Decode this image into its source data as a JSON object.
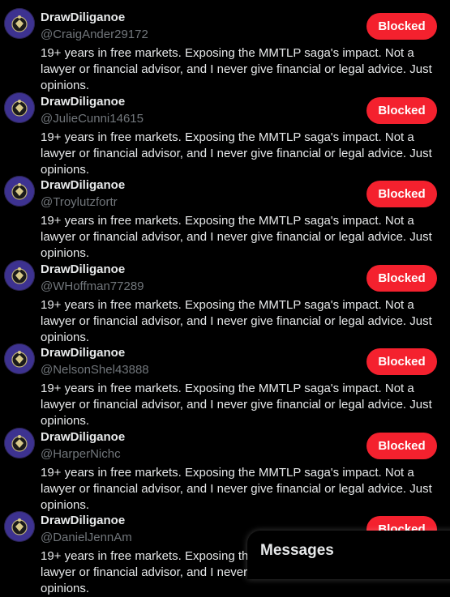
{
  "users": [
    {
      "display_name": "DrawDiliganoe",
      "handle": "@CraigAnder29172",
      "bio": "19+ years in free markets. Exposing the MMTLP saga's impact. Not a lawyer or financial advisor, and I never give financial or legal advice. Just opinions.",
      "button_label": "Blocked"
    },
    {
      "display_name": "DrawDiliganoe",
      "handle": "@JulieCunni14615",
      "bio": "19+ years in free markets. Exposing the MMTLP saga's impact. Not a lawyer or financial advisor, and I never give financial or legal advice. Just opinions.",
      "button_label": "Blocked"
    },
    {
      "display_name": "DrawDiliganoe",
      "handle": "@Troylutzfortr",
      "bio": "19+ years in free markets. Exposing the MMTLP saga's impact. Not a lawyer or financial advisor, and I never give financial or legal advice. Just opinions.",
      "button_label": "Blocked"
    },
    {
      "display_name": "DrawDiliganoe",
      "handle": "@WHoffman77289",
      "bio": "19+ years in free markets. Exposing the MMTLP saga's impact. Not a lawyer or financial advisor, and I never give financial or legal advice. Just opinions.",
      "button_label": "Blocked"
    },
    {
      "display_name": "DrawDiliganoe",
      "handle": "@NelsonShel43888",
      "bio": "19+ years in free markets. Exposing the MMTLP saga's impact. Not a lawyer or financial advisor, and I never give financial or legal advice. Just opinions.",
      "button_label": "Blocked"
    },
    {
      "display_name": "DrawDiliganoe",
      "handle": "@HarperNichc",
      "bio": "19+ years in free markets. Exposing the MMTLP saga's impact. Not a lawyer or financial advisor, and I never give financial or legal advice. Just opinions.",
      "button_label": "Blocked"
    },
    {
      "display_name": "DrawDiliganoe",
      "handle": "@DanielJennAm",
      "bio": "19+ years in free markets. Exposing the MMTLP saga's impact. Not a lawyer or financial advisor, and I never give financial or legal advice. Just opinions.",
      "button_label": "Blocked"
    }
  ],
  "messages_drawer": {
    "title": "Messages"
  },
  "colors": {
    "blocked_button": "#f4212e",
    "handle_gray": "#71767b",
    "text": "#e7e9ea",
    "background": "#000000"
  }
}
